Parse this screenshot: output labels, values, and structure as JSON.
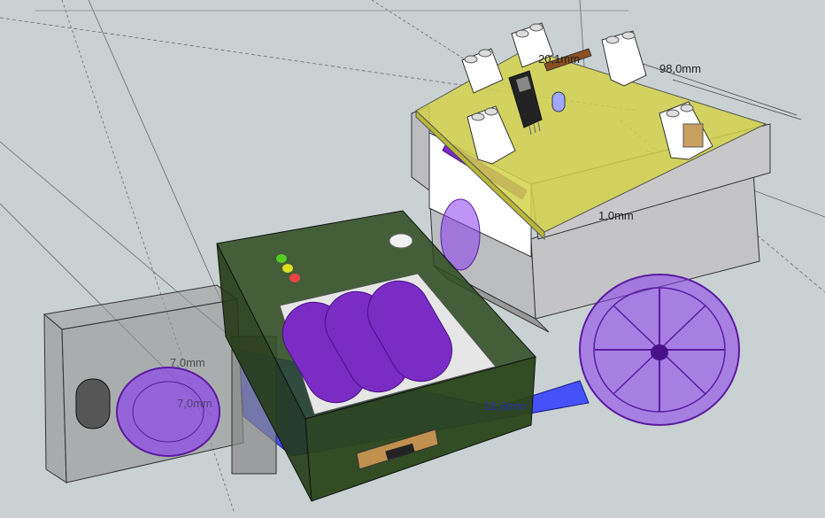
{
  "viewport": {
    "background": "#c9d1d3"
  },
  "dimensions": {
    "top_width": "20,1mm",
    "board_width": "98,0mm",
    "board_thickness": "1,0mm",
    "left_label_1": "7,0mm",
    "left_label_2": "7,0mm",
    "base_height": "16,6mm"
  },
  "colors": {
    "pcb": "#d2d24a",
    "battery": "#7a2cc4",
    "wheel": "#8a3df0",
    "dark_box": "#2d4a1d",
    "grey_box": "#c4c4c6",
    "blue_base": "#2f3cff",
    "led_green": "#55cc22",
    "led_yellow": "#dddd22",
    "led_red": "#ee4444"
  },
  "components": {
    "terminal_blocks": 5,
    "batteries": 3,
    "leds": [
      "green",
      "yellow",
      "red"
    ]
  }
}
